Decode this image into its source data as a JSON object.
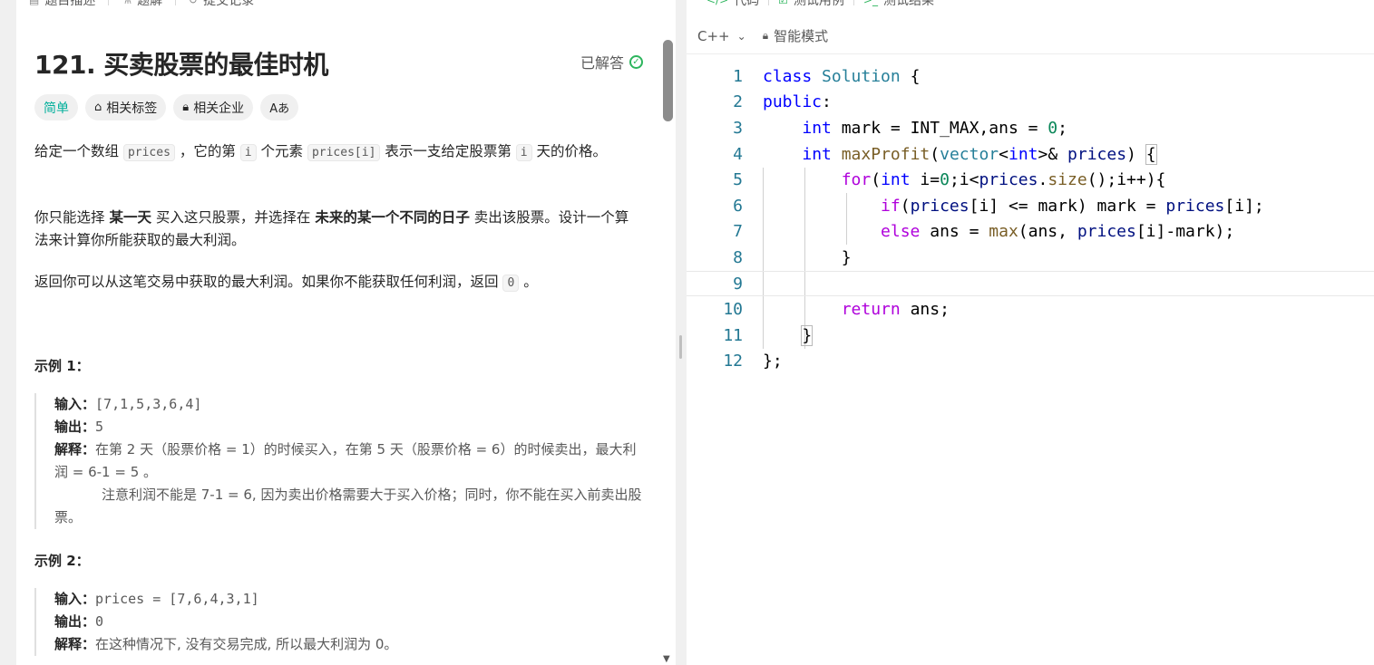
{
  "left_tabs": [
    {
      "icon": "doc-icon",
      "label": "题目描述"
    },
    {
      "icon": "flask-icon",
      "label": "题解"
    },
    {
      "icon": "history-icon",
      "label": "提交记录"
    }
  ],
  "problem": {
    "title": "121. 买卖股票的最佳时机",
    "status": "已解答",
    "tags": [
      "简单",
      "相关标签",
      "相关企业",
      "Aあ"
    ],
    "desc1_a": "给定一个数组 ",
    "desc1_code1": "prices",
    "desc1_b": " ，它的第 ",
    "desc1_code2": "i",
    "desc1_c": " 个元素 ",
    "desc1_code3": "prices[i]",
    "desc1_d": " 表示一支给定股票第 ",
    "desc1_code4": "i",
    "desc1_e": " 天的价格。",
    "desc2_a": "你只能选择 ",
    "desc2_b1": "某一天",
    "desc2_b": " 买入这只股票，并选择在 ",
    "desc2_b2": "未来的某一个不同的日子",
    "desc2_c": " 卖出该股票。设计一个算法来计算你所能获取的最大利润。",
    "desc3_a": "返回你可以从这笔交易中获取的最大利润。如果你不能获取任何利润，返回 ",
    "desc3_code": "0",
    "desc3_b": " 。"
  },
  "examples": [
    {
      "title": "示例 1：",
      "input_label": "输入：",
      "input": "[7,1,5,3,6,4]",
      "output_label": "输出：",
      "output": "5",
      "explain_label": "解释：",
      "explain_1": "在第 2 天（股票价格 = 1）的时候买入，在第 5 天（股票价格 = 6）的时候卖出，最大利润 = 6-1 = 5 。",
      "explain_2": "注意利润不能是 7-1 = 6, 因为卖出价格需要大于买入价格；同时，你不能在买入前卖出股票。"
    },
    {
      "title": "示例 2：",
      "input_label": "输入：",
      "input": "prices = [7,6,4,3,1]",
      "output_label": "输出：",
      "output": "0",
      "explain_label": "解释：",
      "explain_1": "在这种情况下, 没有交易完成, 所以最大利润为 0。"
    }
  ],
  "right_tabs": [
    {
      "icon": "code-icon",
      "label": "代码"
    },
    {
      "icon": "checkbox-icon",
      "label": "测试用例"
    },
    {
      "icon": "terminal-icon",
      "label": "测试结果"
    }
  ],
  "editor": {
    "language": "C++",
    "mode": "智能模式",
    "line_numbers": [
      "1",
      "2",
      "3",
      "4",
      "5",
      "6",
      "7",
      "8",
      "9",
      "10",
      "11",
      "12"
    ]
  },
  "colors": {
    "accent_green": "#2db55d",
    "easy": "#00af9b",
    "keyword": "#0000ff"
  }
}
